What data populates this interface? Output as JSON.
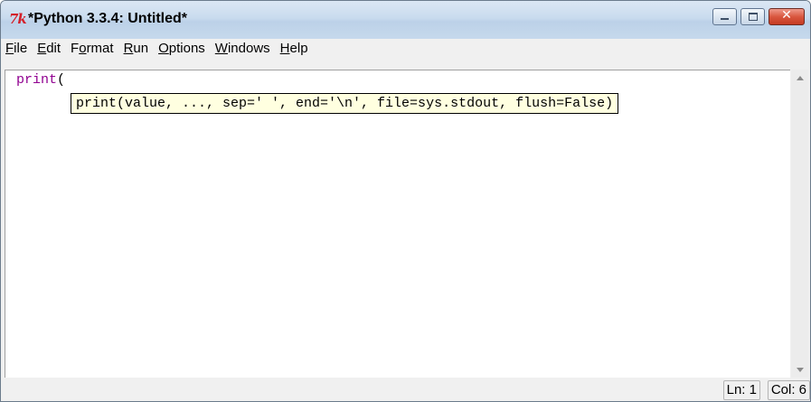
{
  "window": {
    "app_icon_text": "7k",
    "title": "*Python 3.3.4: Untitled*",
    "controls": {
      "minimize_icon": "minimize-icon",
      "maximize_icon": "maximize-icon",
      "close_symbol": "✕"
    }
  },
  "menubar": {
    "items": [
      {
        "underline": "F",
        "rest": "ile"
      },
      {
        "underline": "E",
        "rest": "dit"
      },
      {
        "pre": "F",
        "underline": "o",
        "rest": "rmat"
      },
      {
        "underline": "R",
        "rest": "un"
      },
      {
        "underline": "O",
        "rest": "ptions"
      },
      {
        "underline": "W",
        "rest": "indows"
      },
      {
        "underline": "H",
        "rest": "elp"
      }
    ]
  },
  "editor": {
    "code_keyword": "print",
    "code_paren": "(",
    "calltip": "print(value, ..., sep=' ', end='\\n', file=sys.stdout, flush=False)"
  },
  "statusbar": {
    "line": "Ln: 1",
    "column": "Col: 6"
  },
  "colors": {
    "keyword": "#900090",
    "calltip_bg": "#ffffe0",
    "close_button": "#d9573f",
    "titlebar": "#c9dbee"
  }
}
